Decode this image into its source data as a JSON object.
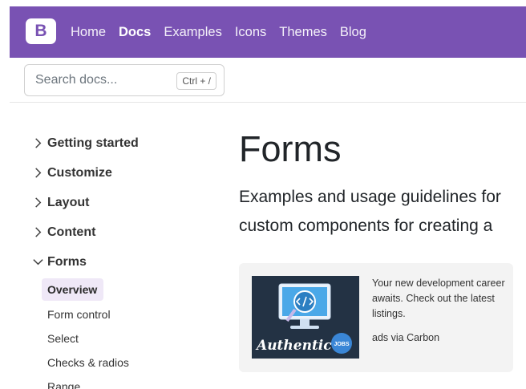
{
  "navbar": {
    "brand": "B",
    "links": [
      {
        "label": "Home",
        "active": false
      },
      {
        "label": "Docs",
        "active": true
      },
      {
        "label": "Examples",
        "active": false
      },
      {
        "label": "Icons",
        "active": false
      },
      {
        "label": "Themes",
        "active": false
      },
      {
        "label": "Blog",
        "active": false
      }
    ],
    "accent": "#7952b3"
  },
  "search": {
    "placeholder": "Search docs...",
    "value": "",
    "shortcut": "Ctrl + /"
  },
  "sidebar": {
    "groups": [
      {
        "label": "Getting started",
        "expanded": false
      },
      {
        "label": "Customize",
        "expanded": false
      },
      {
        "label": "Layout",
        "expanded": false
      },
      {
        "label": "Content",
        "expanded": false
      },
      {
        "label": "Forms",
        "expanded": true
      }
    ],
    "forms_items": [
      {
        "label": "Overview",
        "active": true
      },
      {
        "label": "Form control",
        "active": false
      },
      {
        "label": "Select",
        "active": false
      },
      {
        "label": "Checks & radios",
        "active": false
      },
      {
        "label": "Range",
        "active": false
      }
    ],
    "active_bg": "#efe8f7"
  },
  "main": {
    "title": "Forms",
    "lead_line1": "Examples and usage guidelines for",
    "lead_line2": "custom components for creating a"
  },
  "carbon_ad": {
    "image_text": "Authentic",
    "image_badge": "JOBS",
    "text": "Your new development career awaits. Check out the latest listings.",
    "via": "ads via Carbon",
    "image_bg": "#233244"
  }
}
